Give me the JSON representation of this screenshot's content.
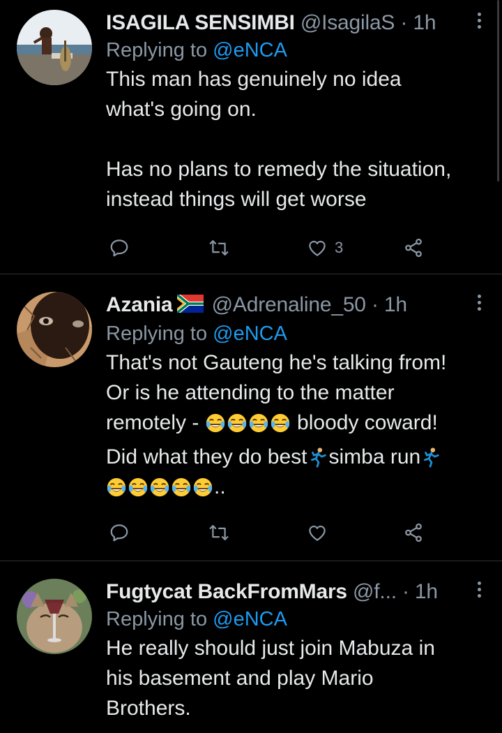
{
  "tweets": [
    {
      "name": "ISAGILA SENSIMBI",
      "handle": "@IsagilaS",
      "separator": "·",
      "time": "1h",
      "replying_prefix": "Replying to ",
      "replying_to": "@eNCA",
      "text": "This man has genuinely no idea\nwhat's going on.\n\nHas no plans to remedy the situation,\ninstead things will get worse",
      "likes": "3",
      "avatar_icon": "warrior-on-rock-avatar"
    },
    {
      "name": "Azania",
      "flag_icon": "south-africa-flag-icon",
      "handle": "@Adrenaline_50",
      "separator": "·",
      "time": "1h",
      "replying_prefix": "Replying to ",
      "replying_to": "@eNCA",
      "text_line1": "That's not Gauteng he's talking from!",
      "text_line2": "Or is he attending to the matter",
      "text_line3a": "remotely - ",
      "text_line3b": " bloody coward!",
      "text_line4a": "Did what they do best",
      "text_line4b": "simba run",
      "text_line5b": "..",
      "likes": "",
      "avatar_icon": "cracked-earth-face-avatar"
    },
    {
      "name": "Fugtycat BackFromMars",
      "handle": "@f...",
      "separator": "·",
      "time": "1h",
      "replying_prefix": "Replying to ",
      "replying_to": "@eNCA",
      "text": "He really should just join Mabuza in\nhis basement and play Mario\nBrothers.",
      "avatar_icon": "cat-drinking-wine-avatar"
    }
  ],
  "colors": {
    "background": "#000000",
    "text": "#e7e9ea",
    "secondary": "#8b98a5",
    "link": "#1d9bf0",
    "divider": "#2f3336"
  },
  "icons": {
    "reply": "reply-icon",
    "retweet": "retweet-icon",
    "like": "heart-icon",
    "share": "share-icon",
    "more": "more-vertical-icon",
    "laughing": "tears-of-joy-emoji",
    "runner": "running-person-emoji"
  }
}
